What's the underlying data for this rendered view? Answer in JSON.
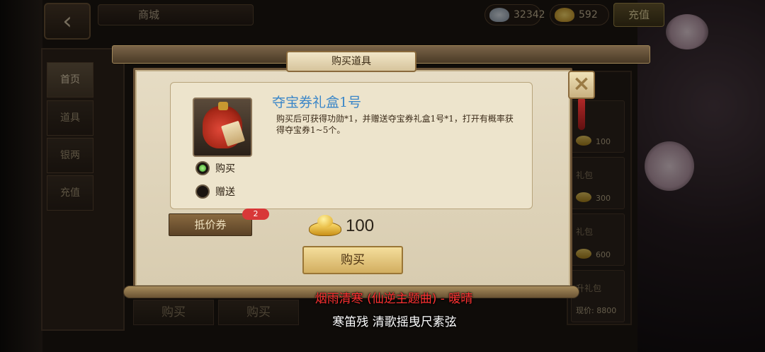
{
  "header": {
    "back_icon": "chevron-left-icon",
    "shop_title": "商城",
    "silver_amount": "32342",
    "gold_amount": "592",
    "recharge_label": "充值"
  },
  "sidebar": {
    "tabs": [
      {
        "label": "首页",
        "active": true
      },
      {
        "label": "道具",
        "active": false
      },
      {
        "label": "银两",
        "active": false
      },
      {
        "label": "充值",
        "active": false
      }
    ]
  },
  "background_items": [
    {
      "name": "",
      "price": "100"
    },
    {
      "name": "礼包",
      "price": "300"
    },
    {
      "name": "礼包",
      "price": "600"
    },
    {
      "name": "升礼包",
      "price": "8800",
      "price_prefix": "现价:"
    }
  ],
  "background_buy_buttons": [
    "购买",
    "购买"
  ],
  "dialog": {
    "title": "购买道具",
    "item_name": "夺宝券礼盒1号",
    "item_description": "购买后可获得功勋*1，并赠送夺宝券礼盒1号*1，打开有概率获得夺宝券1~5个。",
    "item_icon": "treasure-bag-icon",
    "options": [
      {
        "label": "购买",
        "selected": true
      },
      {
        "label": "赠送",
        "selected": false
      }
    ],
    "voucher_label": "抵价券",
    "voucher_count": "2",
    "price": "100",
    "currency_icon": "gold-ingot-icon",
    "buy_label": "购买",
    "close_icon": "close-icon"
  },
  "lyrics": {
    "line1": "烟雨清寒 (仙逆主题曲) - 暖晴",
    "line2": "寒笛残 清歌摇曳尺素弦"
  },
  "colors": {
    "item_name": "#3a86c8",
    "lyric_line1": "#ff3232",
    "lyric_line2": "#ffffff",
    "buy_button": "#e4c47e",
    "voucher_badge": "#d83838"
  }
}
